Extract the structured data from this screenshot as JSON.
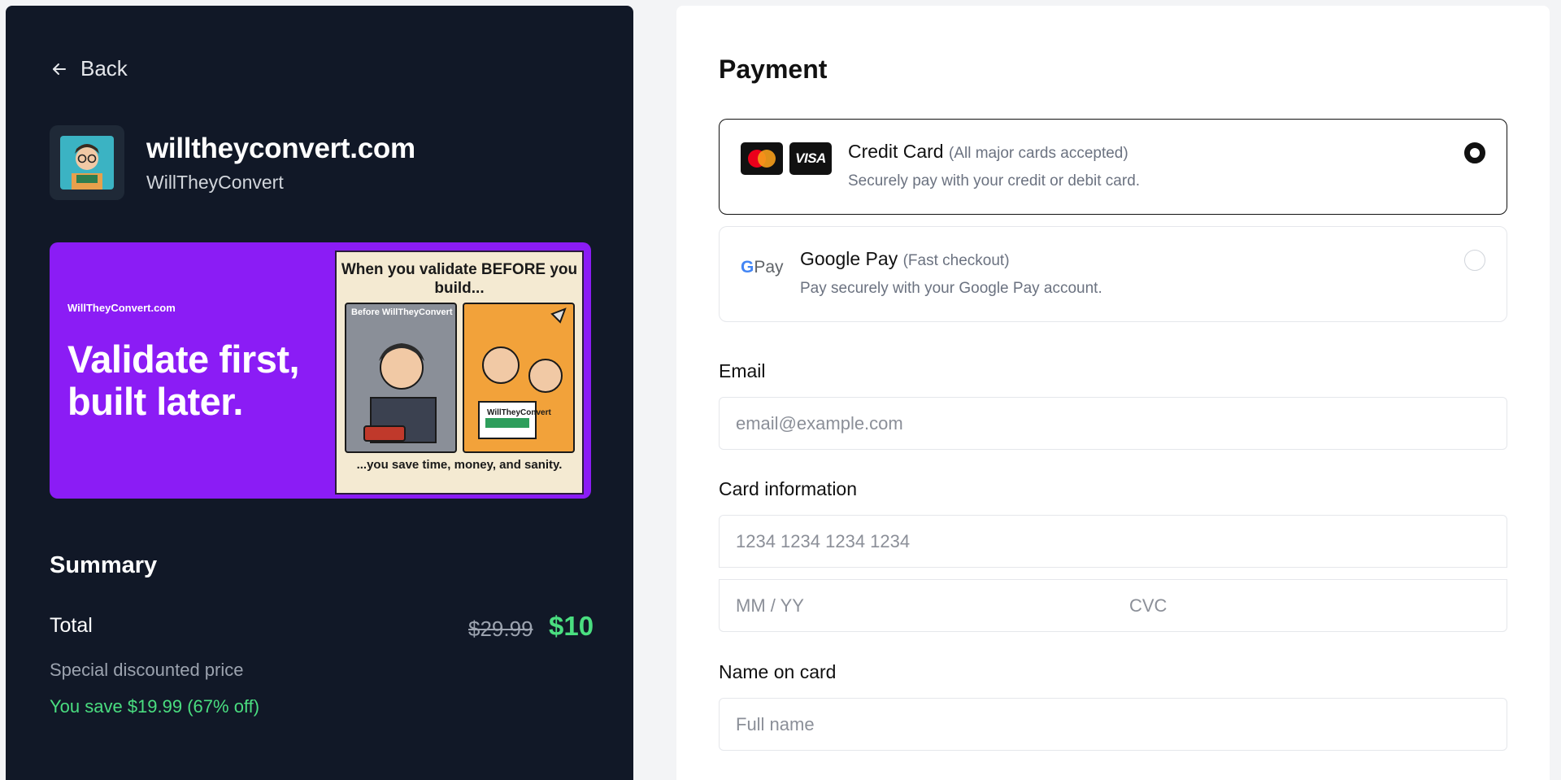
{
  "nav": {
    "back_label": "Back"
  },
  "product": {
    "title": "willtheyconvert.com",
    "subtitle": "WillTheyConvert"
  },
  "banner": {
    "brand": "WillTheyConvert.com",
    "headline": "Validate first, built later.",
    "comic_top": "When you validate BEFORE you build...",
    "panel_a_label": "Before WillTheyConvert",
    "panel_b_label": "WillTheyConvert",
    "comic_bottom": "...you save time, money, and sanity."
  },
  "summary": {
    "heading": "Summary",
    "total_label": "Total",
    "original_price": "$29.99",
    "price": "$10",
    "discount_note": "Special discounted price",
    "savings": "You save $19.99 (67% off)"
  },
  "payment": {
    "heading": "Payment",
    "options": [
      {
        "title": "Credit Card",
        "note": "(All major cards accepted)",
        "desc": "Securely pay with your credit or debit card.",
        "selected": true
      },
      {
        "title": "Google Pay",
        "note": "(Fast checkout)",
        "desc": "Pay securely with your Google Pay account.",
        "selected": false
      }
    ],
    "card_brand": "VISA",
    "gpay_logo": "Pay"
  },
  "form": {
    "email_label": "Email",
    "email_placeholder": "email@example.com",
    "card_label": "Card information",
    "card_placeholder": "1234 1234 1234 1234",
    "expiry_placeholder": "MM / YY",
    "cvc_placeholder": "CVC",
    "name_label": "Name on card",
    "name_placeholder": "Full name"
  },
  "colors": {
    "accent_green": "#4ade80",
    "panel_dark": "#111827",
    "banner_purple": "#8b1cf5"
  }
}
